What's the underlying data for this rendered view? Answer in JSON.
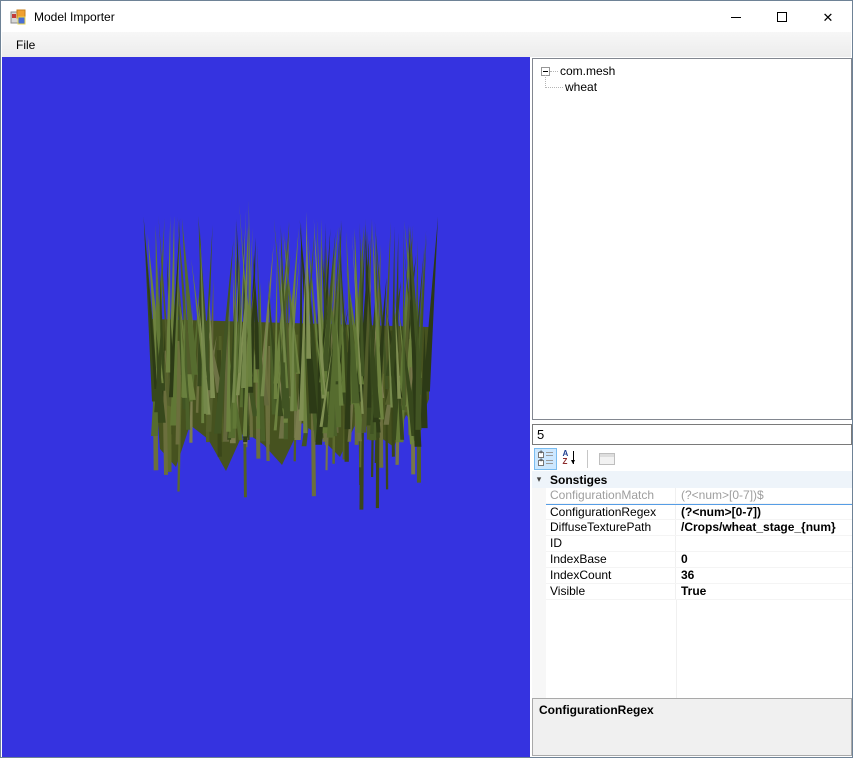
{
  "window": {
    "title": "Model Importer",
    "controls": {
      "minimize": "minimize",
      "maximize": "maximize",
      "close": "close"
    }
  },
  "menu": {
    "items": [
      {
        "label": "File"
      }
    ]
  },
  "viewport": {
    "background_color": "#3533e0",
    "model_name": "wheat crop model (crossed billboard grass planes)"
  },
  "tree": {
    "root_label": "com.mesh",
    "child_label": "wheat"
  },
  "filter_box": {
    "value": "5"
  },
  "toolbar": {
    "categorized_button": "categorized",
    "alphabetical_button": "alphabetical",
    "property_pages_button": "property-pages"
  },
  "property_grid": {
    "category_label": "Sonstiges",
    "rows": [
      {
        "name": "ConfigurationMatch",
        "value": "(?<num>[0-7])$",
        "state": "readonly"
      },
      {
        "name": "ConfigurationRegex",
        "value": "(?<num>[0-7])",
        "state": "selected"
      },
      {
        "name": "DiffuseTexturePath",
        "value": "/Crops/wheat_stage_{num}",
        "state": "normal"
      },
      {
        "name": "ID",
        "value": "",
        "state": "normal"
      },
      {
        "name": "IndexBase",
        "value": "0",
        "state": "normal"
      },
      {
        "name": "IndexCount",
        "value": "36",
        "state": "normal"
      },
      {
        "name": "Visible",
        "value": "True",
        "state": "normal"
      }
    ]
  },
  "help_panel": {
    "title": "ConfigurationRegex"
  },
  "colors": {
    "viewport_blue": "#3533e0",
    "window_border": "#6e8296",
    "selected_row_line": "#569de5",
    "toolbar_selected_bg": "#cde8ff"
  }
}
